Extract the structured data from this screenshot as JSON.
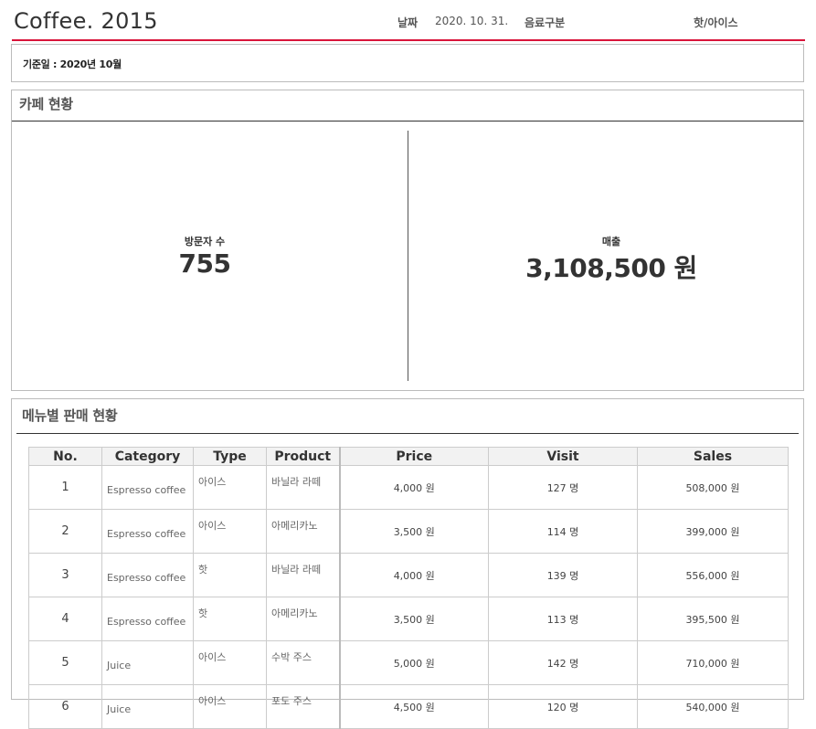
{
  "header": {
    "title": "Coffee. 2015",
    "date_label": "날짜",
    "date_value": "2020. 10. 31.",
    "drink_type_label": "음료구분",
    "drink_type_value": "핫/아이스"
  },
  "basis": {
    "text": "기준일 : 2020년 10월"
  },
  "cafe_status": {
    "title": "카페 현황",
    "visitors": {
      "label": "방문자 수",
      "value": "755"
    },
    "sales": {
      "label": "매출",
      "value": "3,108,500 원"
    }
  },
  "menu_sales": {
    "title": "메뉴별 판매 현황",
    "columns": [
      "No.",
      "Category",
      "Type",
      "Product",
      "Price",
      "Visit",
      "Sales"
    ],
    "rows": [
      [
        "1",
        "Espresso coffee",
        "아이스",
        "바닐라 라떼",
        "4,000 원",
        "127 명",
        "508,000 원"
      ],
      [
        "2",
        "Espresso coffee",
        "아이스",
        "아메리카노",
        "3,500 원",
        "114 명",
        "399,000 원"
      ],
      [
        "3",
        "Espresso coffee",
        "핫",
        "바닐라 라떼",
        "4,000 원",
        "139 명",
        "556,000 원"
      ],
      [
        "4",
        "Espresso coffee",
        "핫",
        "아메리카노",
        "3,500 원",
        "113 명",
        "395,500 원"
      ],
      [
        "5",
        "Juice",
        "아이스",
        "수박 주스",
        "5,000 원",
        "142 명",
        "710,000 원"
      ],
      [
        "6",
        "Juice",
        "아이스",
        "포도 주스",
        "4,500 원",
        "120 명",
        "540,000 원"
      ]
    ]
  },
  "colors": {
    "accent": "#d8143a",
    "header_bg": "#f2f2f2"
  }
}
